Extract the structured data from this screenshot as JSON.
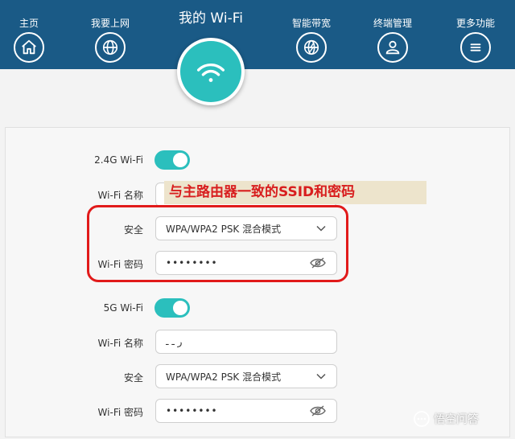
{
  "nav": {
    "items": [
      {
        "label": "主页",
        "icon": "home-icon"
      },
      {
        "label": "我要上网",
        "icon": "globe-icon"
      },
      {
        "label": "智能带宽",
        "icon": "bandwidth-icon"
      },
      {
        "label": "终端管理",
        "icon": "user-icon"
      },
      {
        "label": "更多功能",
        "icon": "menu-icon"
      }
    ],
    "active_title": "我的 Wi-Fi",
    "active_icon": "wifi-icon"
  },
  "wifi_24g": {
    "toggle_label": "2.4G Wi-Fi",
    "enabled": true,
    "name_label": "Wi-Fi 名称",
    "name_value": "",
    "security_label": "安全",
    "security_value": "WPA/WPA2 PSK 混合模式",
    "password_label": "Wi-Fi 密码",
    "password_value": "••••••••"
  },
  "wifi_5g": {
    "toggle_label": "5G Wi-Fi",
    "enabled": true,
    "name_label": "Wi-Fi 名称",
    "name_value": "ر ـ ـ",
    "security_label": "安全",
    "security_value": "WPA/WPA2 PSK 混合模式",
    "password_label": "Wi-Fi 密码",
    "password_value": "••••••••"
  },
  "annotation": {
    "text": "与主路由器一致的SSID和密码",
    "color": "#d81e1e"
  },
  "watermark": {
    "text": "悟空问答"
  },
  "colors": {
    "header": "#1a5a86",
    "accent": "#2bbfbd",
    "highlight": "#e11a1a"
  }
}
